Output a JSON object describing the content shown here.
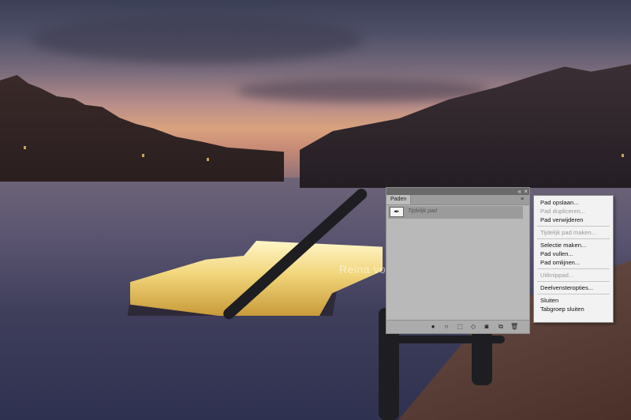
{
  "photo": {
    "watermark": "Reina voor De Fotoblogger"
  },
  "paths_panel": {
    "controls": [
      "«",
      "×"
    ],
    "tab_label": "Paden",
    "menu_glyph": "≡",
    "path_item": {
      "name": "Tijdelijk pad",
      "thumb_glyph": "✒"
    },
    "bottom_icons": [
      {
        "name": "fill-path-icon",
        "glyph": "●"
      },
      {
        "name": "stroke-path-icon",
        "glyph": "○"
      },
      {
        "name": "load-selection-icon",
        "glyph": "⬚"
      },
      {
        "name": "make-path-from-selection-icon",
        "glyph": "◇"
      },
      {
        "name": "add-mask-icon",
        "glyph": "◙"
      },
      {
        "name": "new-path-icon",
        "glyph": "⧉"
      },
      {
        "name": "trash-icon",
        "glyph": "🗑"
      }
    ]
  },
  "context_menu": {
    "items": [
      {
        "label": "Pad opslaan...",
        "disabled": false
      },
      {
        "label": "Pad dupliceren...",
        "disabled": true
      },
      {
        "label": "Pad verwijderen",
        "disabled": false
      },
      {
        "separator": true
      },
      {
        "label": "Tijdelijk pad maken...",
        "disabled": true
      },
      {
        "separator": true
      },
      {
        "label": "Selectie maken...",
        "disabled": false
      },
      {
        "label": "Pad vullen...",
        "disabled": false
      },
      {
        "label": "Pad omlijnen...",
        "disabled": false
      },
      {
        "separator": true
      },
      {
        "label": "Uitknippad...",
        "disabled": true
      },
      {
        "separator": true
      },
      {
        "label": "Deelvensteropties...",
        "disabled": false
      },
      {
        "separator": true
      },
      {
        "label": "Sluiten",
        "disabled": false
      },
      {
        "label": "Tabgroep sluiten",
        "disabled": false
      }
    ]
  }
}
